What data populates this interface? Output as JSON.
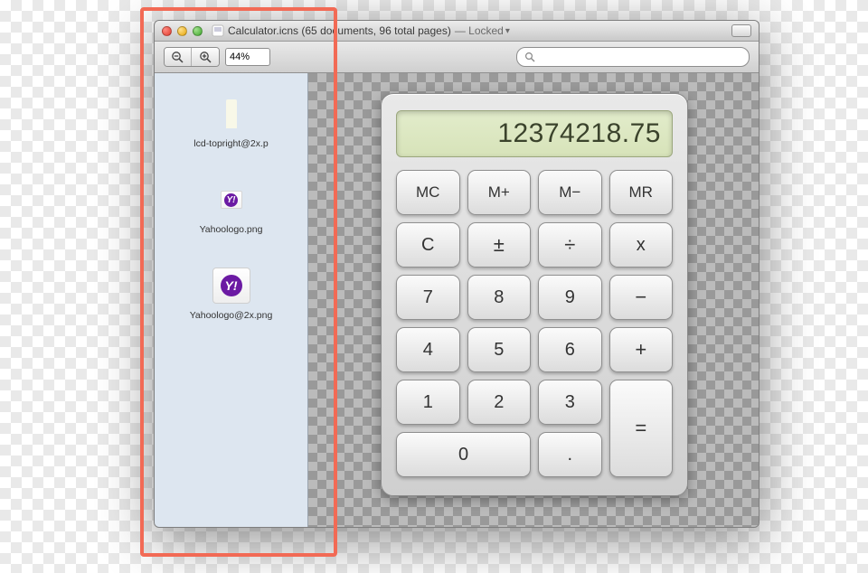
{
  "window": {
    "title_filename": "Calculator.icns",
    "title_meta": "(65 documents, 96 total pages)",
    "locked_label": "— Locked",
    "chevron": "▾"
  },
  "toolbar": {
    "zoom_out_glyph": "⊖",
    "zoom_in_glyph": "⊕",
    "zoom_value": "44%",
    "search_icon": "🔍",
    "search_placeholder": ""
  },
  "sidebar": {
    "items": [
      {
        "id": "lcd-topright",
        "label": "lcd-topright@2x.p",
        "kind": "lcd"
      },
      {
        "id": "yahoologo",
        "label": "Yahoologo.png",
        "kind": "yahoo-small"
      },
      {
        "id": "yahoologo2x",
        "label": "Yahoologo@2x.png",
        "kind": "yahoo-big"
      }
    ]
  },
  "calculator": {
    "display": "12374218.75",
    "keys": [
      [
        "MC",
        "M+",
        "M−",
        "MR"
      ],
      [
        "C",
        "±",
        "÷",
        "x"
      ],
      [
        "7",
        "8",
        "9",
        "−"
      ],
      [
        "4",
        "5",
        "6",
        "+"
      ],
      [
        "1",
        "2",
        "3",
        "="
      ],
      [
        "0",
        ".",
        null,
        null
      ]
    ]
  }
}
